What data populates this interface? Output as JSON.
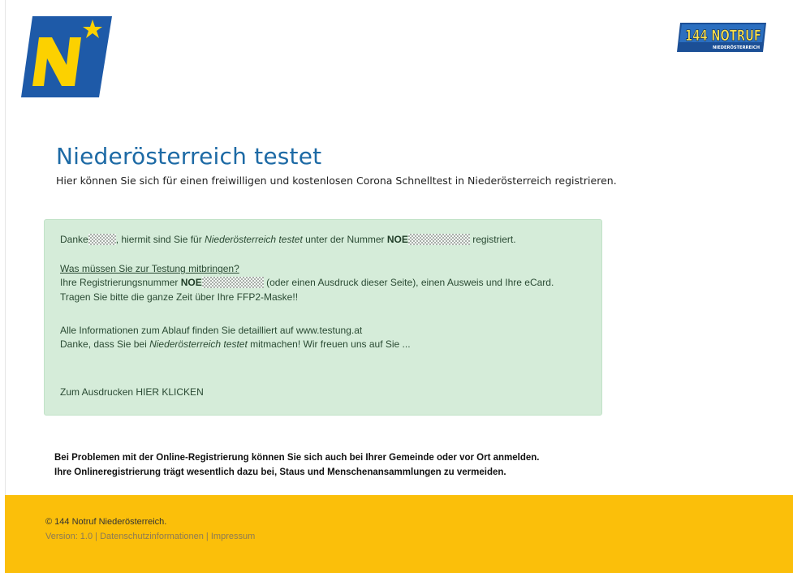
{
  "branding": {
    "left_logo_icon": "niederoesterreich-n-star-logo",
    "right_logo_text": "144 NOTRUF",
    "right_logo_subtext": "NIEDERÖSTERREICH",
    "colors": {
      "noe_blue": "#1e5aa8",
      "noe_yellow": "#fcd100",
      "title_blue": "#1d6aa5",
      "alert_bg": "#d5ecd9",
      "footer_yellow": "#fbbf0a"
    }
  },
  "header": {
    "title": "Niederösterreich testet",
    "subtitle": "Hier können Sie sich für einen freiwilligen und kostenlosen Corona Schnelltest in Niederösterreich registrieren."
  },
  "confirmation": {
    "thanks_prefix": "Danke",
    "thanks_middle": ", hiermit sind Sie für ",
    "program_name": "Niederösterreich testet",
    "number_prefix_text": " unter der Nummer ",
    "number_prefix": "NOE",
    "registered_suffix": " registriert.",
    "bring_heading": "Was müssen Sie zur Testung mitbringen?",
    "bring_text_prefix": "Ihre Registrierungsnummer ",
    "bring_text_suffix": " (oder einen Ausdruck dieser Seite), einen Ausweis und Ihre eCard.",
    "mask_text": "Tragen Sie bitte die ganze Zeit über Ihre FFP2-Maske!!",
    "info_text": "Alle Informationen zum Ablauf finden Sie detailliert auf www.testung.at",
    "thanks_participation_prefix": "Danke, dass Sie bei ",
    "thanks_participation_suffix": " mitmachen! Wir freuen uns auf Sie ...",
    "print_link": "Zum Ausdrucken HIER KLICKEN"
  },
  "notice": {
    "line1": "Bei Problemen mit der Online-Registrierung können Sie sich auch bei Ihrer Gemeinde oder vor Ort anmelden.",
    "line2": "Ihre Onlineregistrierung trägt wesentlich dazu bei, Staus und Menschenansammlungen zu vermeiden."
  },
  "footer": {
    "copyright": "© 144 Notruf Niederösterreich.",
    "version": "Version: 1.0",
    "separator": " | ",
    "privacy_link": "Datenschutzinformationen",
    "imprint_link": "Impressum"
  }
}
